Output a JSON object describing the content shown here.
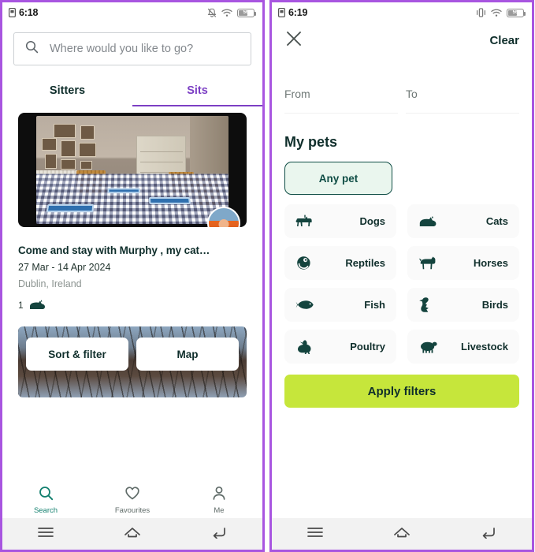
{
  "theme": {
    "frame_purple": "#a855e0",
    "accent_purple": "#7c3fc4",
    "dark_teal": "#0f2e2b",
    "teal": "#13806f",
    "lime": "#c6e63b",
    "mint_fill": "#eaf6ee"
  },
  "left_panel": {
    "statusbar": {
      "time": "6:18",
      "sim_icon": "sim-card-icon",
      "notification_icon": "notifications-off-icon",
      "wifi_icon": "wifi-icon",
      "battery_icon": "battery-icon",
      "battery_level": "56"
    },
    "search": {
      "icon": "search-icon",
      "placeholder": "Where would you like to go?",
      "value": ""
    },
    "tabs": [
      {
        "label": "Sitters",
        "active": false
      },
      {
        "label": "Sits",
        "active": true
      }
    ],
    "listing": {
      "photo_alt": "dining-room-photo",
      "avatar_alt": "host-avatar",
      "title": "Come and stay with Murphy , my cat…",
      "dates": "27 Mar - 14 Apr 2024",
      "location": "Dublin, Ireland",
      "pet_count": "1",
      "pet_icon": "cat-icon"
    },
    "floating_buttons": [
      {
        "label": "Sort & filter",
        "name": "sort-filter-button"
      },
      {
        "label": "Map",
        "name": "map-button"
      }
    ],
    "bottom_nav": [
      {
        "label": "Search",
        "icon": "search-icon",
        "active": true
      },
      {
        "label": "Favourites",
        "icon": "heart-icon",
        "active": false
      },
      {
        "label": "Me",
        "icon": "person-icon",
        "active": false
      }
    ],
    "system_nav": [
      {
        "name": "recents-button",
        "icon": "menu-icon"
      },
      {
        "name": "home-button",
        "icon": "home-icon"
      },
      {
        "name": "back-button",
        "icon": "back-icon"
      }
    ]
  },
  "right_panel": {
    "statusbar": {
      "time": "6:19",
      "sim_icon": "sim-card-icon",
      "notification_icon": "vibrate-icon",
      "wifi_icon": "wifi-icon",
      "battery_icon": "battery-icon",
      "battery_level": "56"
    },
    "header": {
      "close_icon": "close-icon",
      "clear_label": "Clear"
    },
    "dates": {
      "from_label": "From",
      "from_value": "",
      "to_label": "To",
      "to_value": ""
    },
    "pets_section": {
      "title": "My pets",
      "any_pet_label": "Any pet",
      "any_pet_selected": true,
      "options": [
        {
          "label": "Dogs",
          "icon": "dog-icon",
          "selected": false
        },
        {
          "label": "Cats",
          "icon": "cat-icon",
          "selected": false
        },
        {
          "label": "Reptiles",
          "icon": "reptile-icon",
          "selected": false
        },
        {
          "label": "Horses",
          "icon": "horse-icon",
          "selected": false
        },
        {
          "label": "Fish",
          "icon": "fish-icon",
          "selected": false
        },
        {
          "label": "Birds",
          "icon": "bird-icon",
          "selected": false
        },
        {
          "label": "Poultry",
          "icon": "poultry-icon",
          "selected": false
        },
        {
          "label": "Livestock",
          "icon": "livestock-icon",
          "selected": false
        }
      ]
    },
    "apply_label": "Apply filters",
    "system_nav": [
      {
        "name": "recents-button",
        "icon": "menu-icon"
      },
      {
        "name": "home-button",
        "icon": "home-icon"
      },
      {
        "name": "back-button",
        "icon": "back-icon"
      }
    ]
  }
}
